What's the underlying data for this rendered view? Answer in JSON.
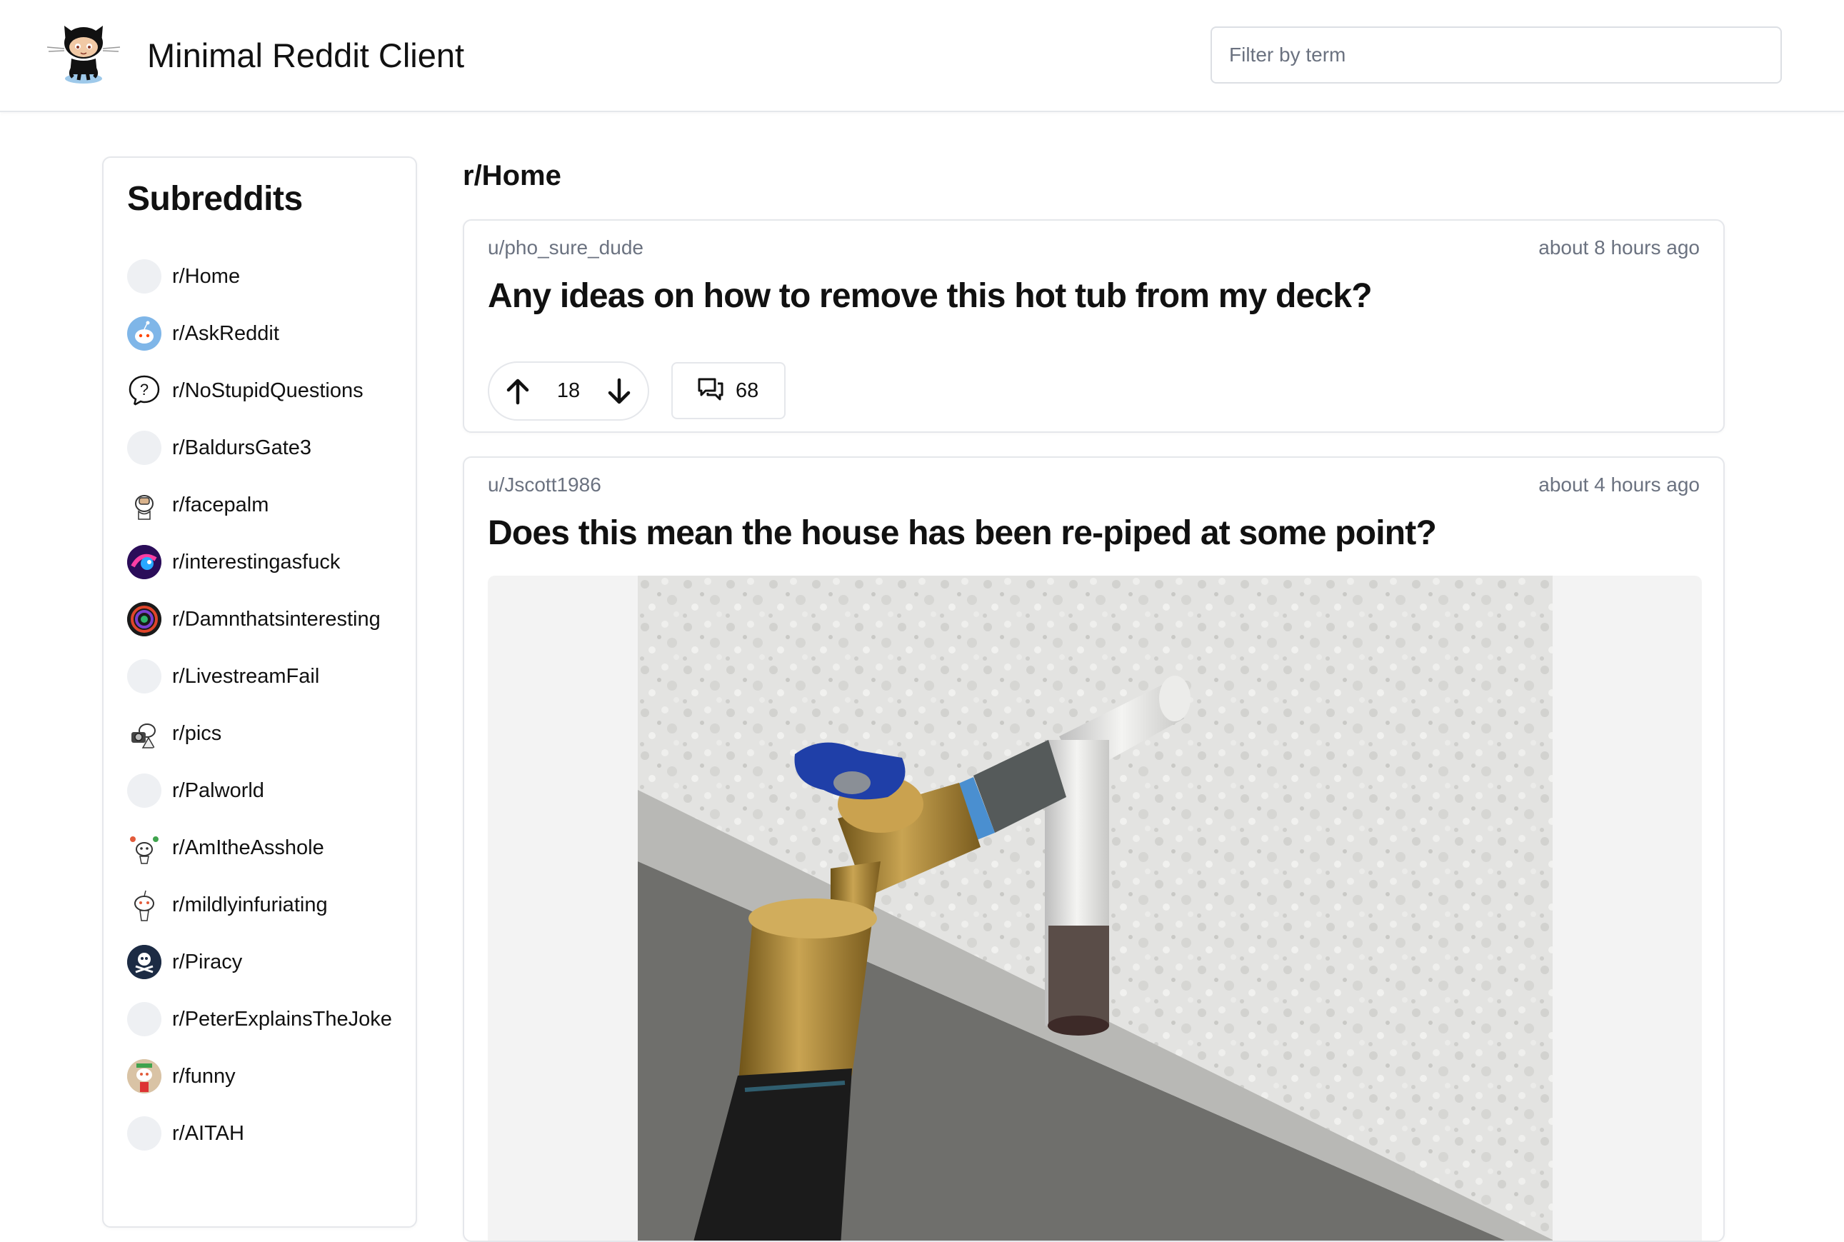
{
  "app": {
    "title": "Minimal Reddit Client",
    "logo_icon": "octocat-logo"
  },
  "search": {
    "placeholder": "Filter by term"
  },
  "sidebar": {
    "title": "Subreddits",
    "items": [
      {
        "label": "r/Home",
        "icon": "blank-avatar"
      },
      {
        "label": "r/AskReddit",
        "icon": "snoo-avatar"
      },
      {
        "label": "r/NoStupidQuestions",
        "icon": "question-bubble-icon"
      },
      {
        "label": "r/BaldursGate3",
        "icon": "blank-avatar"
      },
      {
        "label": "r/facepalm",
        "icon": "facepalm-avatar"
      },
      {
        "label": "r/interestingasfuck",
        "icon": "colorful-avatar"
      },
      {
        "label": "r/Damnthatsinteresting",
        "icon": "swirl-avatar"
      },
      {
        "label": "r/LivestreamFail",
        "icon": "blank-avatar"
      },
      {
        "label": "r/pics",
        "icon": "camera-snoo-avatar"
      },
      {
        "label": "r/Palworld",
        "icon": "blank-avatar"
      },
      {
        "label": "r/AmItheAsshole",
        "icon": "snoo-avatar"
      },
      {
        "label": "r/mildlyinfuriating",
        "icon": "snoo-avatar"
      },
      {
        "label": "r/Piracy",
        "icon": "skull-avatar"
      },
      {
        "label": "r/PeterExplainsTheJoke",
        "icon": "blank-avatar"
      },
      {
        "label": "r/funny",
        "icon": "funny-avatar"
      },
      {
        "label": "r/AITAH",
        "icon": "blank-avatar"
      }
    ]
  },
  "feed": {
    "title": "r/Home",
    "posts": [
      {
        "author": "u/pho_sure_dude",
        "time": "about 8 hours ago",
        "title": "Any ideas on how to remove this hot tub from my deck?",
        "votes": "18",
        "comments": "68"
      },
      {
        "author": "u/Jscott1986",
        "time": "about 4 hours ago",
        "title": "Does this mean the house has been re-piped at some point?"
      }
    ]
  },
  "colors": {
    "border": "#e5e7eb",
    "muted_text": "#6b7280",
    "text": "#111111",
    "valve_blue": "#1f3fa8",
    "brass": "#b08a3a"
  }
}
